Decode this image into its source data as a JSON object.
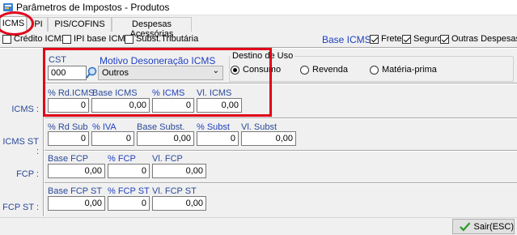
{
  "window": {
    "title": "Parâmetros de Impostos - Produtos",
    "icon": "app-icon"
  },
  "tabs": [
    {
      "label": "ICMS",
      "active": true
    },
    {
      "label": "IPI",
      "active": false
    },
    {
      "label": "PIS/COFINS",
      "active": false
    },
    {
      "label": "Despesas Acessórias",
      "active": false
    }
  ],
  "options": {
    "credito_icms": {
      "label": "Crédito ICMS",
      "checked": false
    },
    "ipi_base_icms": {
      "label": "IPI base ICMS",
      "checked": false
    },
    "subst_tributaria": {
      "label": "Subst.Tributária",
      "checked": false
    }
  },
  "base_icms": {
    "label": "Base ICMS :",
    "frete": {
      "label": "Frete",
      "checked": true
    },
    "seguro": {
      "label": "Seguro",
      "checked": true
    },
    "outras_despesas": {
      "label": "Outras Despesas",
      "checked": true
    }
  },
  "icms": {
    "row_label": "ICMS :",
    "cst_label": "CST",
    "cst_value": "000",
    "motivo_label": "Motivo Desoneração ICMS",
    "motivo_value": "Outros",
    "destino": {
      "title": "Destino de Uso",
      "options": [
        "Consumo",
        "Revenda",
        "Matéria-prima"
      ],
      "selected": "Consumo"
    },
    "perc_rd_label": "% Rd.ICMS",
    "perc_rd_value": "0",
    "base_label": "Base ICMS",
    "base_value": "0,00",
    "perc_label": "% ICMS",
    "perc_value": "0",
    "vl_label": "Vl. ICMS",
    "vl_value": "0,00"
  },
  "icms_st": {
    "row_label": "ICMS ST :",
    "rd_sub_label": "% Rd Sub",
    "rd_sub_value": "0",
    "iva_label": "% IVA",
    "iva_value": "0",
    "base_label": "Base Subst.",
    "base_value": "0,00",
    "perc_label": "% Subst",
    "perc_value": "0",
    "vl_label": "Vl. Subst",
    "vl_value": "0,00"
  },
  "fcp": {
    "row_label": "FCP :",
    "base_label": "Base FCP",
    "base_value": "0,00",
    "perc_label": "% FCP",
    "perc_value": "0",
    "vl_label": "Vl. FCP",
    "vl_value": "0,00"
  },
  "fcp_st": {
    "row_label": "FCP ST :",
    "base_label": "Base FCP ST",
    "base_value": "0,00",
    "perc_label": "% FCP ST",
    "perc_value": "0",
    "vl_label": "Vl. FCP ST",
    "vl_value": "0,00"
  },
  "footer": {
    "exit_label": "Sair(ESC)"
  },
  "colors": {
    "highlight": "#e2001a",
    "label_blue": "#2a4a9a",
    "accent_blue": "#1f3fbf"
  }
}
